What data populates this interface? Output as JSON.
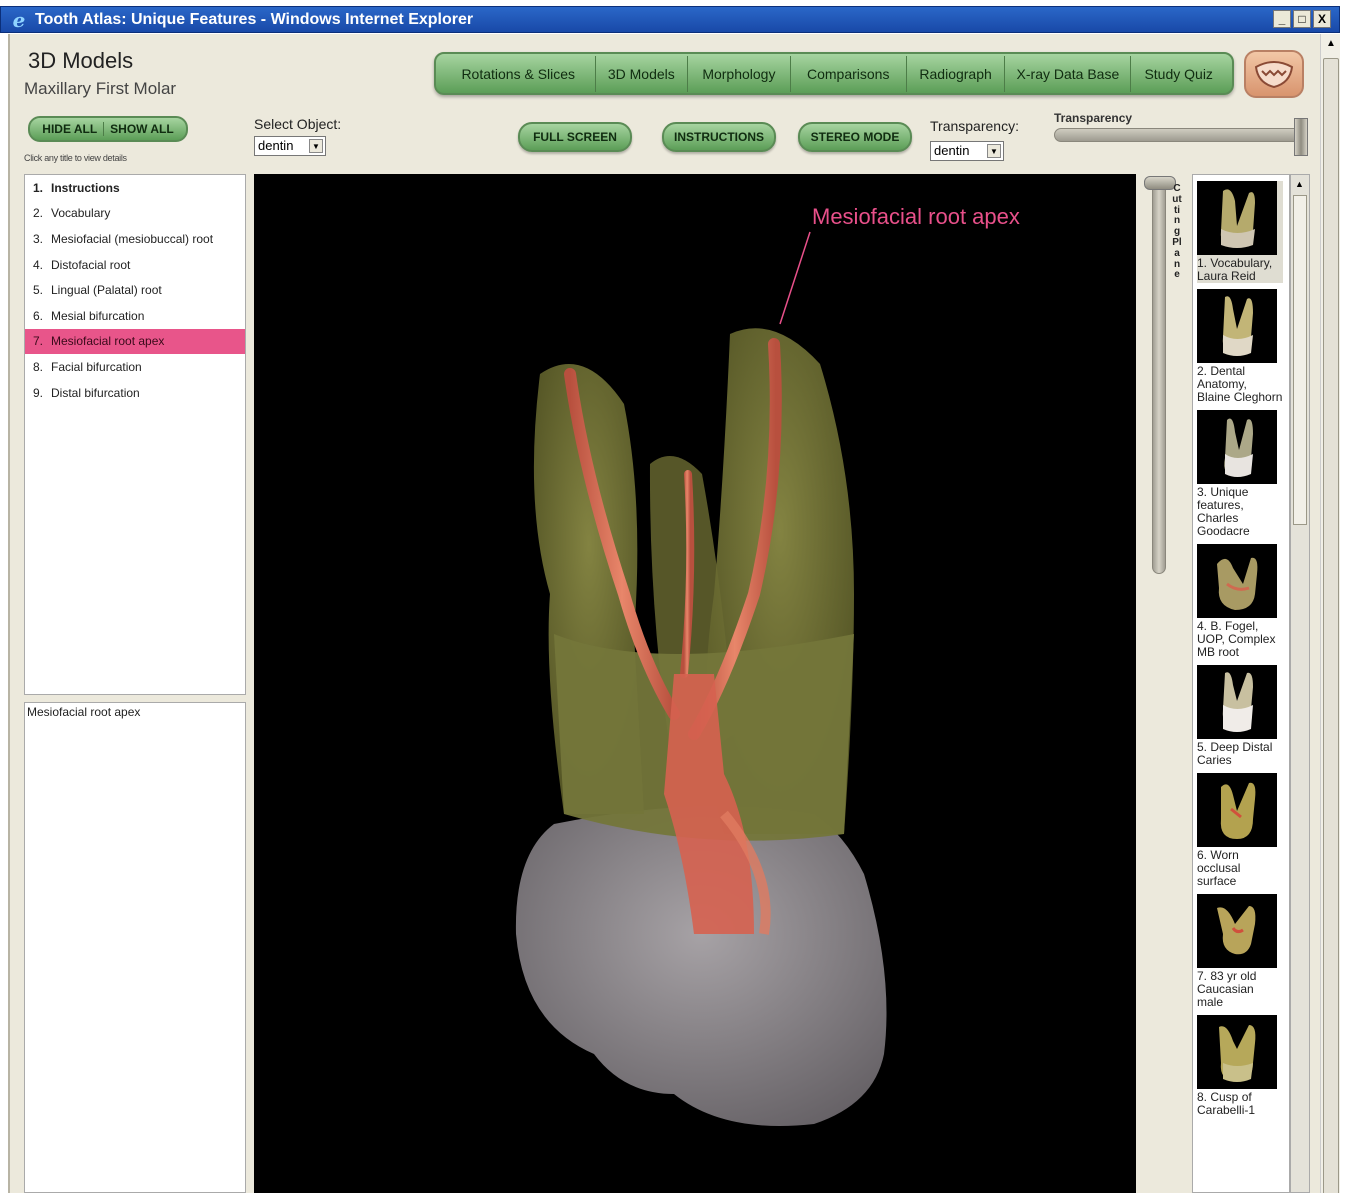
{
  "window": {
    "title": "Tooth Atlas: Unique Features - Windows Internet Explorer",
    "icon": "ie-icon",
    "controls": [
      "_",
      "□",
      "X"
    ]
  },
  "header": {
    "title": "3D Models",
    "subtitle": "Maxillary First Molar"
  },
  "nav": {
    "tabs": [
      {
        "label": "Rotations & Slices"
      },
      {
        "label": "3D Models"
      },
      {
        "label": "Morphology"
      },
      {
        "label": "Comparisons"
      },
      {
        "label": "Radiograph"
      },
      {
        "label": "X-ray Data Base"
      },
      {
        "label": "Study Quiz"
      }
    ],
    "logo_icon": "tooth-logo-icon"
  },
  "controls": {
    "hide_all": "HIDE ALL",
    "show_all": "SHOW ALL",
    "hint": "Click any title to view details",
    "select_object_label": "Select Object:",
    "select_object_value": "dentin",
    "full_screen": "FULL SCREEN",
    "instructions": "INSTRUCTIONS",
    "stereo_mode": "STEREO MODE",
    "transparency_label": "Transparency:",
    "transparency_value": "dentin",
    "transparency_slider_label": "Transparency",
    "transparency_level": 1.0
  },
  "features": {
    "items": [
      {
        "num": "1.",
        "label": "Instructions"
      },
      {
        "num": "2.",
        "label": "Vocabulary"
      },
      {
        "num": "3.",
        "label": "Mesiofacial (mesiobuccal) root"
      },
      {
        "num": "4.",
        "label": "Distofacial root"
      },
      {
        "num": "5.",
        "label": "Lingual (Palatal) root"
      },
      {
        "num": "6.",
        "label": "Mesial bifurcation"
      },
      {
        "num": "7.",
        "label": "Mesiofacial root apex"
      },
      {
        "num": "8.",
        "label": "Facial bifurcation"
      },
      {
        "num": "9.",
        "label": "Distal bifurcation"
      }
    ],
    "selected_index": 6,
    "selected_color": "#e8558a"
  },
  "detail": {
    "title": "Mesiofacial root apex"
  },
  "viewer": {
    "annotation": "Mesiofacial root apex",
    "annotation_color": "#e8508a",
    "background": "#000000"
  },
  "cutting_plane": {
    "label": "Cutting Plane"
  },
  "thumbnails": [
    {
      "caption": "1. Vocabulary, Laura Reid"
    },
    {
      "caption": "2. Dental Anatomy, Blaine Cleghorn"
    },
    {
      "caption": "3. Unique features, Charles Goodacre"
    },
    {
      "caption": "4. B. Fogel, UOP, Complex MB root"
    },
    {
      "caption": "5. Deep Distal Caries"
    },
    {
      "caption": "6. Worn occlusal surface"
    },
    {
      "caption": "7. 83 yr old Caucasian male"
    },
    {
      "caption": "8. Cusp of Carabelli-1"
    }
  ]
}
